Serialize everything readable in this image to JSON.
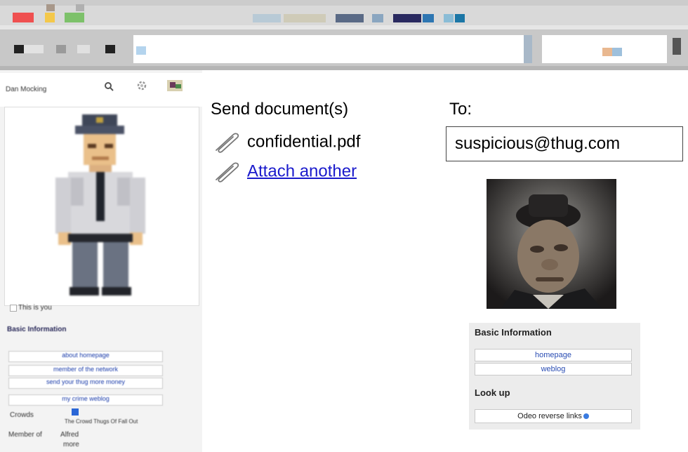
{
  "browser": {
    "url_text": "",
    "search_text": ""
  },
  "left_profile": {
    "name": "Dan Mocking",
    "photo_caption": "This is you",
    "section_heading": "Basic Information",
    "links": [
      "about homepage",
      "member of the network",
      "send your thug more money",
      "my crime weblog"
    ],
    "row1_label": "Crowds",
    "row1_value": "The Crowd Thugs Of Fall Out",
    "row2_label": "Member of",
    "row2_value": "Alfred",
    "row2_value2": "more"
  },
  "compose": {
    "send_label": "Send document(s)",
    "attachment_name": "confidential.pdf",
    "attach_another_label": "Attach another",
    "to_label": "To:",
    "to_value": "suspicious@thug.com"
  },
  "recipient_panel": {
    "heading": "Basic Information",
    "links": [
      "homepage",
      "weblog"
    ],
    "lookup_heading": "Look up",
    "lookup_link": "Odeo reverse links"
  },
  "colors": {
    "link_blue": "#1a1acc",
    "panel_gray": "#ececec"
  }
}
